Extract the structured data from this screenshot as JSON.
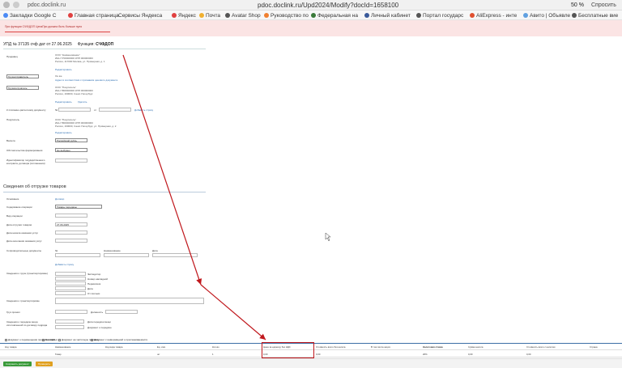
{
  "browser": {
    "site_label": "pdoc.doclink.ru",
    "title": "pdoc.doclink.ru/Upd2024/Modify?docId=1658100",
    "zoom": "50 %",
    "ask_label": "Спросить"
  },
  "bookmarks": [
    {
      "label": "Закладки Google C",
      "color": "#4a8af4"
    },
    {
      "label": "Главная страница",
      "color": "#e04040"
    },
    {
      "label": "Сервисы Яндекса",
      "color": "#f1f1f1"
    },
    {
      "label": "Яндекс",
      "color": "#e04040"
    },
    {
      "label": "Почта",
      "color": "#f0b030"
    },
    {
      "label": "Avatar Shop",
      "color": "#555555"
    },
    {
      "label": "Руководство по",
      "color": "#f08030"
    },
    {
      "label": "Федеральная на",
      "color": "#3a7a3a"
    },
    {
      "label": "Личный кабинет",
      "color": "#3a5a9a"
    },
    {
      "label": "Портал государс",
      "color": "#555555"
    },
    {
      "label": "AliExpress - инте",
      "color": "#e05030"
    },
    {
      "label": "Авито | Объявле",
      "color": "#60a0e0"
    },
    {
      "label": "Бесплатные вие",
      "color": "#555555"
    }
  ],
  "alert": {
    "text": "При функции СЧФ/ДОП ЦенаПри должна быть больше нуля"
  },
  "header": {
    "doc_label": "УПД № 37135 счф дат от 27.06.2025",
    "function_label": "Функция:",
    "function_value": "СЧФДОП"
  },
  "form": {
    "seller_label": "Продавец",
    "seller_name": "ООО \"Наименование\"",
    "seller_inn": "ИНН 7700000000 КПП 000000000",
    "seller_addr": "Россия, 117000 Москва, ул. Примерная, д. 1",
    "seller_edit": "Редактировать",
    "shipper_label": "Грузоотправитель",
    "shipper_value": "Он же",
    "shipper_link": "Адрес в соответствии с признаком ценового документа",
    "consignee_label": "Грузополучатель",
    "consignee_name": "ООО \"Покупатель\"",
    "consignee_inn": "ИНН 7800000000 КПП 000000000",
    "consignee_addr": "Россия, 190000, Санкт-Петербург",
    "consignee_edit": "Редактировать",
    "consignee_delete": "Удалить",
    "payment_doc_label": "К платежно-расчетному документу",
    "payment_doc_no": "№",
    "payment_doc_from": "от",
    "payment_doc_add": "Добавить строку",
    "buyer_label": "Покупатель",
    "buyer_name": "ООО \"Покупатель\"",
    "buyer_inn": "ИНН 7800000000 КПП 000000000",
    "buyer_addr": "Россия, 190000, Санкт-Петербург, ул. Примерная, д. 2",
    "buyer_edit": "Редактировать",
    "currency_label": "Валюта",
    "currency_value": "Российский рубль",
    "gov_label": "Обстоятельства формирования",
    "gov_value": "Не выбрано",
    "contract_label": "Идентификатор государственного контракта, договора (соглашения)",
    "shipment_title": "Сведения об отгрузке товаров",
    "basis_label": "Основание",
    "basis_link": "Договор",
    "op_content_label": "Содержание операции",
    "op_content_value": "Товары переданы",
    "op_type_label": "Вид операции",
    "ship_date_label": "Дата отгрузки товаров",
    "ship_date_value": "27.06.2025",
    "start_date_label": "Дата начала оказания услуг",
    "end_date_label": "Дата окончания оказания услуг",
    "ship_docs_label": "Сопроводительные документы",
    "ship_docs_no": "№",
    "ship_docs_name": "Наименование",
    "ship_docs_date": "Дата",
    "add_doc_link": "Добавить строку",
    "cargo_label": "Сведения о грузе (транспортировке)",
    "cargo_fields": [
      "Экспедитор",
      "Номер накладной",
      "Перевозчик",
      "Дата",
      "От скольки"
    ],
    "transfer_label": "Сведения о транспортировке",
    "accepted_label": "Груз принял",
    "position_label": "Должность",
    "signer_label": "Сведения о передаче вещи, изготовленной по договору подряда",
    "signer_date": "Дата передачи вещи",
    "signer_doc": "Документ о передаче"
  },
  "checkboxes": [
    "Документ о перемещении прослеживаемых",
    "Без НДС",
    "Документ на частичную поставку",
    "Документ с информацией о прослеживаемости"
  ],
  "table": {
    "headers": [
      "Код товара",
      "Наименование",
      "Код вида товара",
      "Ед. изм.",
      "Кол-во",
      "Цена за единицу без НДС",
      "Стоимость всего без налога",
      "В том числе акциз",
      "Налоговая ставка",
      "Сумма налога",
      "Стоимость всего с налогом",
      "Страна"
    ],
    "row": [
      "",
      "Товар",
      "",
      "шт",
      "1",
      "0,00",
      "0,00",
      "",
      "20%",
      "0,00",
      "0,00",
      ""
    ]
  },
  "buttons": {
    "save": "Сохранить документ",
    "validate": "Проверить"
  },
  "annotation_color": "#c0181d"
}
